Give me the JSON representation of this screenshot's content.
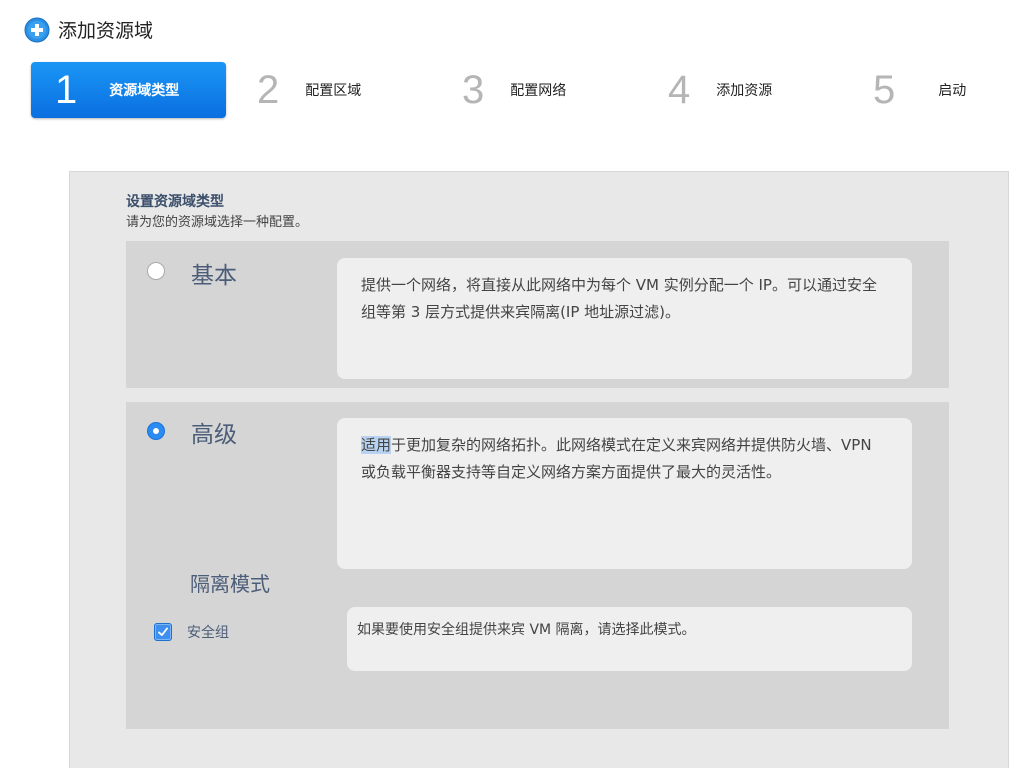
{
  "header": {
    "title": "添加资源域",
    "icon": "add-circle-icon"
  },
  "steps": [
    {
      "number": "1",
      "label": "资源域类型",
      "active": true
    },
    {
      "number": "2",
      "label": "配置区域",
      "active": false
    },
    {
      "number": "3",
      "label": "配置网络",
      "active": false
    },
    {
      "number": "4",
      "label": "添加资源",
      "active": false
    },
    {
      "number": "5",
      "label": "启动",
      "active": false
    }
  ],
  "section": {
    "title": "设置资源域类型",
    "subtitle": "请为您的资源域选择一种配置。"
  },
  "options": {
    "basic": {
      "name": "基本",
      "selected": false,
      "description": "提供一个网络，将直接从此网络中为每个 VM 实例分配一个 IP。可以通过安全组等第 3 层方式提供来宾隔离(IP 地址源过滤)。"
    },
    "advanced": {
      "name": "高级",
      "selected": true,
      "description_highlight": "适用",
      "description_rest": "于更加复杂的网络拓扑。此网络模式在定义来宾网络并提供防火墙、VPN 或负载平衡器支持等自定义网络方案方面提供了最大的灵活性。",
      "isolation": {
        "title": "隔离模式",
        "security_group_label": "安全组",
        "security_group_checked": true,
        "security_group_description": "如果要使用安全组提供来宾 VM 隔离，请选择此模式。"
      }
    }
  },
  "colors": {
    "accent": "#0a6fe0",
    "panel": "#e8e8e8",
    "option": "#d5d5d5",
    "label": "#4b5d78"
  }
}
